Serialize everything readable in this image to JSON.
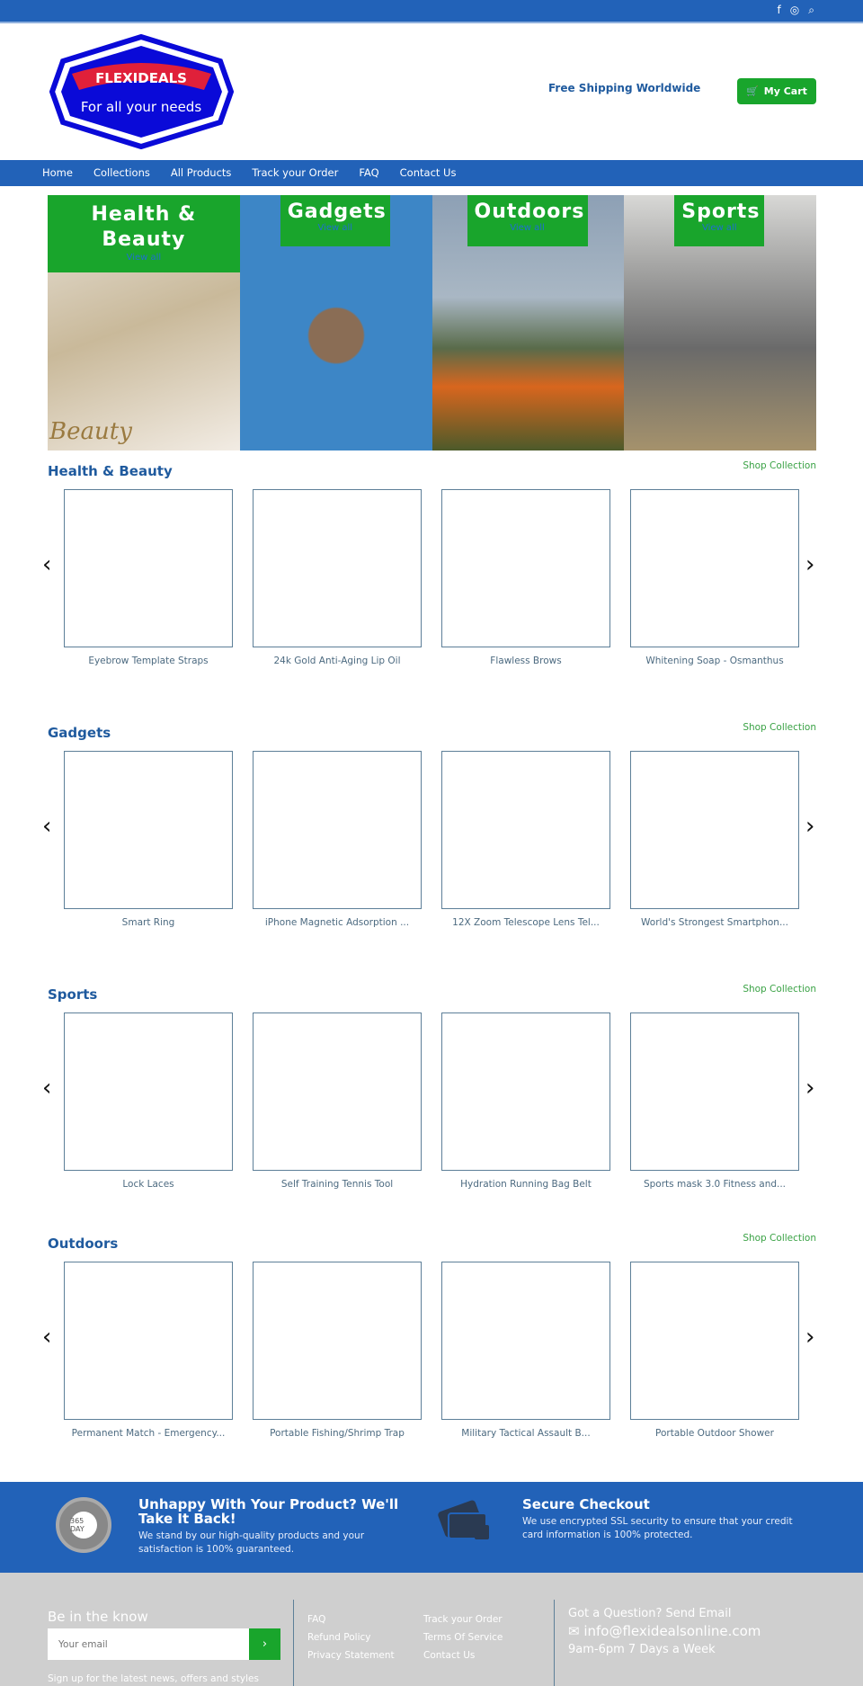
{
  "topbar": {
    "icons": [
      "facebook-icon",
      "instagram-icon",
      "search-icon"
    ]
  },
  "header": {
    "logo_text": "FLEXIDEALS",
    "logo_tagline": "For all your needs",
    "shipping": "Free Shipping Worldwide",
    "cart_label": "My Cart"
  },
  "nav": [
    "Home",
    "Collections",
    "All Products",
    "Track your Order",
    "FAQ",
    "Contact Us"
  ],
  "banners": [
    {
      "title": "Health & Beauty",
      "link": "View all",
      "caption": "Beauty"
    },
    {
      "title": "Gadgets",
      "link": "View all"
    },
    {
      "title": "Outdoors",
      "link": "View all"
    },
    {
      "title": "Sports",
      "link": "View all"
    }
  ],
  "sections": [
    {
      "title": "Health & Beauty",
      "shop": "Shop Collection",
      "products": [
        "Eyebrow Template Straps",
        "24k Gold Anti-Aging Lip Oil",
        "Flawless Brows",
        "Whitening Soap - Osmanthus"
      ]
    },
    {
      "title": "Gadgets",
      "shop": "Shop Collection",
      "products": [
        "Smart Ring",
        "iPhone Magnetic Adsorption ...",
        "12X Zoom Telescope Lens Tel...",
        "World's Strongest Smartphon..."
      ]
    },
    {
      "title": "Sports",
      "shop": "Shop Collection",
      "products": [
        "Lock Laces",
        "Self Training Tennis Tool",
        "Hydration Running Bag Belt",
        "Sports mask 3.0 Fitness and..."
      ]
    },
    {
      "title": "Outdoors",
      "shop": "Shop Collection",
      "products": [
        "Permanent Match - Emergency...",
        "Portable Fishing/Shrimp Trap",
        "Military Tactical Assault B...",
        "Portable Outdoor Shower"
      ]
    }
  ],
  "guarantee": {
    "badge": "365 DAY",
    "title": "Unhappy With Your Product? We'll Take It Back!",
    "text": "We stand by our high-quality products and your satisfaction is 100% guaranteed."
  },
  "secure": {
    "title": "Secure Checkout",
    "text": "We use encrypted SSL security to ensure that your credit card information is 100% protected."
  },
  "footer": {
    "newsletter_title": "Be in the know",
    "email_placeholder": "Your email",
    "signup_text": "Sign up for the latest news, offers and styles",
    "links": [
      "FAQ",
      "Track your Order",
      "Refund Policy",
      "Terms Of Service",
      "Privacy Statement",
      "Contact Us"
    ],
    "contact_title": "Got a Question? Send Email",
    "email": "info@flexidealsonline.com",
    "hours": "9am-6pm 7 Days a Week"
  },
  "colors": {
    "primary": "#2262b8",
    "green": "#19a52c",
    "footer": "#cfcfcf"
  }
}
